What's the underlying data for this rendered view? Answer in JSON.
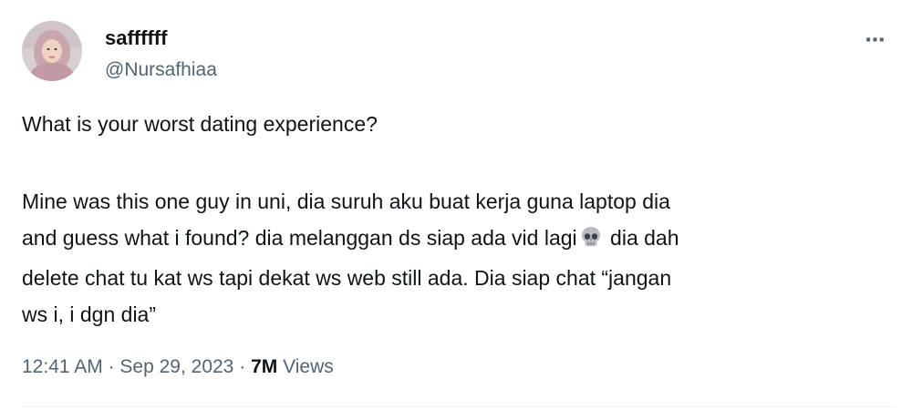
{
  "author": {
    "display_name": "saffffff",
    "handle": "@Nursafhiaa"
  },
  "more_icon": "⋯",
  "tweet": {
    "question": "What is your worst dating experience?",
    "lines": [
      "Mine was this one guy in uni, dia suruh aku buat kerja guna laptop dia",
      "and guess what i found? dia melanggan ds siap ada vid lagi",
      "dia dah",
      "delete chat tu kat ws tapi dekat ws web still ada. Dia siap chat “jangan",
      "ws i, i dgn dia”"
    ],
    "emoji": "skull-icon"
  },
  "meta": {
    "time": "12:41 AM",
    "separator": "·",
    "date": "Sep 29, 2023",
    "views_count": "7M",
    "views_label": "Views"
  },
  "colors": {
    "text_primary": "#0f1419",
    "text_secondary": "#536471",
    "divider": "#eff3f4"
  }
}
